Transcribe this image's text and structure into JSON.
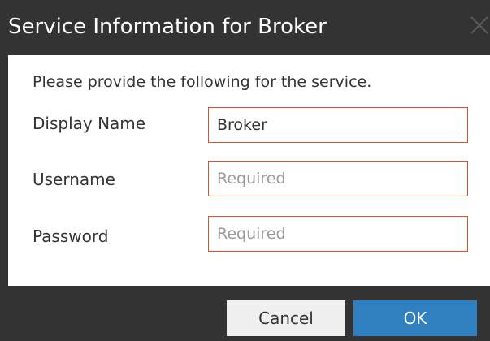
{
  "dialog": {
    "title": "Service Information for Broker",
    "intro": "Please provide the following for the service.",
    "fields": [
      {
        "label": "Display Name",
        "value": "Broker",
        "placeholder": ""
      },
      {
        "label": "Username",
        "value": "",
        "placeholder": "Required"
      },
      {
        "label": "Password",
        "value": "",
        "placeholder": "Required"
      }
    ],
    "buttons": {
      "cancel": "Cancel",
      "ok": "OK"
    }
  },
  "colors": {
    "chrome": "#333333",
    "field_border": "#d8532b",
    "primary_button": "#2f7fc1"
  },
  "icons": {
    "close": "close-icon"
  }
}
